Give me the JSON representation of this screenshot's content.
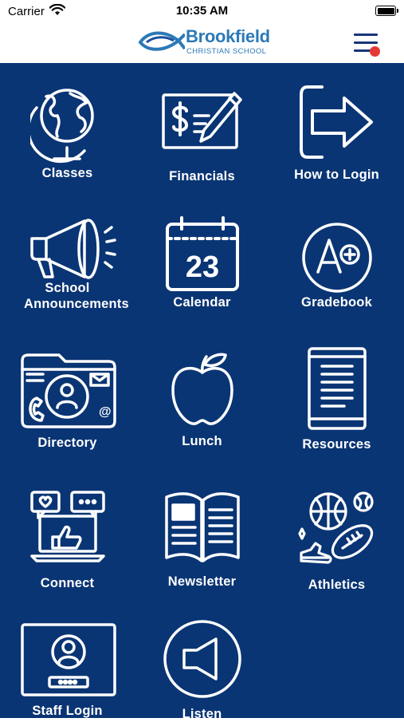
{
  "status_bar": {
    "carrier": "Carrier",
    "time": "10:35 AM"
  },
  "header": {
    "logo_name": "Brookfield",
    "logo_subtitle": "CHRISTIAN SCHOOL",
    "menu_icon": "hamburger-menu-icon",
    "notification_color": "#e53935"
  },
  "colors": {
    "background": "#0a3574",
    "brand": "#2b79b8",
    "text": "#ffffff"
  },
  "tiles": [
    {
      "label": "Classes",
      "icon": "globe-icon"
    },
    {
      "label": "Financials",
      "icon": "check-pen-icon"
    },
    {
      "label": "How to Login",
      "icon": "login-arrow-icon"
    },
    {
      "label": "School Announcements",
      "icon": "megaphone-icon"
    },
    {
      "label": "Calendar",
      "icon": "calendar-icon",
      "day": "23"
    },
    {
      "label": "Gradebook",
      "icon": "grade-a-plus-icon"
    },
    {
      "label": "Directory",
      "icon": "contact-folder-icon"
    },
    {
      "label": "Lunch",
      "icon": "apple-icon"
    },
    {
      "label": "Resources",
      "icon": "tablet-icon"
    },
    {
      "label": "Connect",
      "icon": "social-laptop-icon"
    },
    {
      "label": "Newsletter",
      "icon": "newspaper-icon"
    },
    {
      "label": "Athletics",
      "icon": "sports-balls-icon"
    },
    {
      "label": "Staff Login",
      "icon": "staff-badge-icon"
    },
    {
      "label": "Listen",
      "icon": "speaker-icon"
    }
  ]
}
